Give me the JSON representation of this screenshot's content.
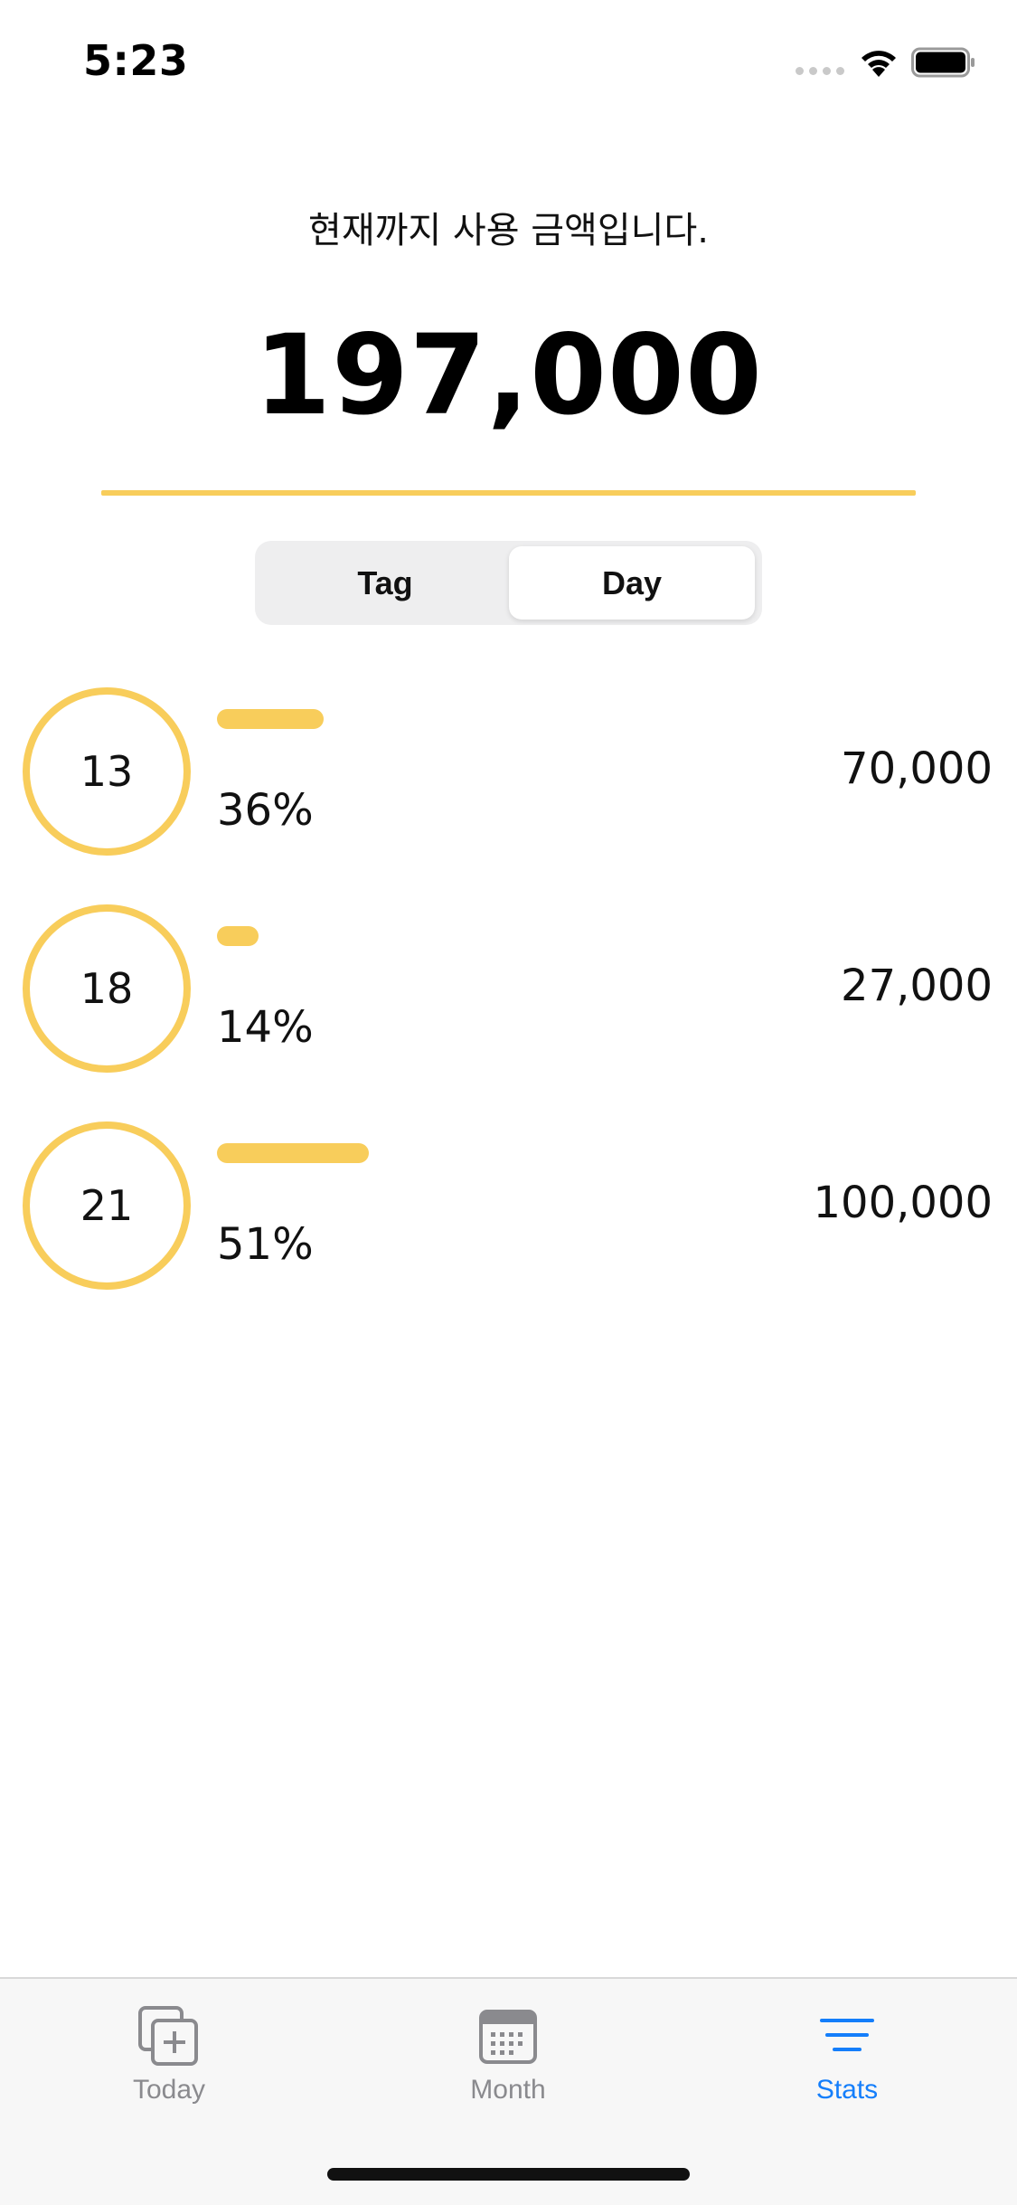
{
  "status_bar": {
    "time": "5:23"
  },
  "header": {
    "subtitle": "현재까지 사용 금액입니다.",
    "total": "197,000"
  },
  "segmented": {
    "options": [
      "Tag",
      "Day"
    ],
    "selected": "Day"
  },
  "rows": [
    {
      "day": "13",
      "percent_label": "36%",
      "share": 0.36,
      "amount": "70,000"
    },
    {
      "day": "18",
      "percent_label": "14%",
      "share": 0.14,
      "amount": "27,000"
    },
    {
      "day": "21",
      "percent_label": "51%",
      "share": 0.51,
      "amount": "100,000"
    }
  ],
  "tab_bar": {
    "tabs": [
      {
        "label": "Today",
        "icon": "square-stack-plus-icon",
        "active": false
      },
      {
        "label": "Month",
        "icon": "calendar-icon",
        "active": false
      },
      {
        "label": "Stats",
        "icon": "list-lines-icon",
        "active": true
      }
    ]
  },
  "colors": {
    "accent": "#f8cd5b",
    "tab_active": "#147efb",
    "tab_inactive": "#8a8a8e"
  }
}
